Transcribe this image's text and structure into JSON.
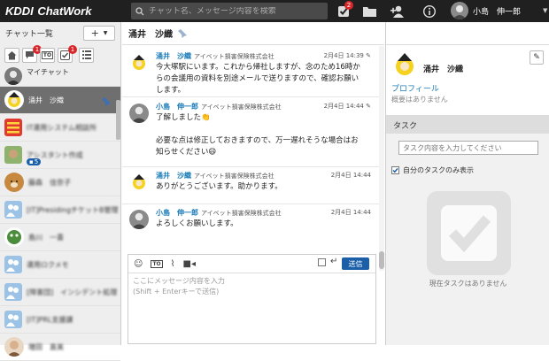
{
  "app": {
    "logo_kddi": "KDDI",
    "logo_chatwork": "ChatWork"
  },
  "topbar": {
    "search_placeholder": "チャット名、メッセージ内容を検索",
    "task_badge": "2",
    "user_name": "小島　伸一郎"
  },
  "left": {
    "header": "チャット一覧",
    "add_label": "+",
    "filter_badges": [
      "1",
      "1"
    ],
    "rooms": [
      {
        "name": "マイチャット",
        "blurred": false
      },
      {
        "name": "涌井　沙織",
        "blurred": false,
        "selected": true
      },
      {
        "name": "IT運用システム相談所",
        "blurred": true
      },
      {
        "name": "アシスタント作成",
        "blurred": true,
        "badge": "5"
      },
      {
        "name": "藤森　佳奈子",
        "blurred": true
      },
      {
        "name": "[IT]PresidingチケットB管理（ステータスなど）",
        "blurred": true
      },
      {
        "name": "島川　一喜",
        "blurred": true
      },
      {
        "name": "運用ロクメモ",
        "blurred": true
      },
      {
        "name": "[障害団]　インシデント処理",
        "blurred": true
      },
      {
        "name": "[IT]PRL支援課",
        "blurred": true
      },
      {
        "name": "増田　直美",
        "blurred": true
      }
    ]
  },
  "chat": {
    "title": "涌井　沙織",
    "messages": [
      {
        "sender": "涌井　沙織",
        "company": "アイベット損害保険株式会社",
        "time": "2月4日 14:39",
        "lines": [
          "今大塚駅にいます。これから帰社しますが、念のため16時か",
          "らの会議用の資料を別途メールで送りますので、確認お願い",
          "します。"
        ]
      },
      {
        "sender": "小島　伸一郎",
        "company": "アイベット損害保険株式会社",
        "time": "2月4日 14:44",
        "lines": [
          "了解しました👏",
          "",
          "必要な点は修正しておきますので、万一遅れそうな場合はお",
          "知らせください😄"
        ]
      },
      {
        "sender": "涌井　沙織",
        "company": "アイベット損害保険株式会社",
        "time": "2月4日 14:44",
        "lines": [
          "ありがとうございます。助かります。"
        ]
      },
      {
        "sender": "小島　伸一郎",
        "company": "アイベット損害保険株式会社",
        "time": "2月4日 14:44",
        "lines": [
          "よろしくお願いします。"
        ]
      }
    ],
    "composer": {
      "placeholder_line1": "ここにメッセージ内容を入力",
      "placeholder_line2": "(Shift + Enterキーで送信)",
      "send_label": "送信",
      "to_label": "TO"
    }
  },
  "right": {
    "profile_name": "涌井　沙織",
    "profile_link": "プロフィール",
    "profile_note": "概要はありません",
    "task_header": "タスク",
    "task_placeholder": "タスク内容を入力してください",
    "my_task_label": "自分のタスクのみ表示",
    "no_task": "現在タスクはありません"
  },
  "colors": {
    "accent": "#1a5fa8",
    "topbar": "#202020",
    "badge": "#d9262b",
    "name_link": "#1a7cb8"
  }
}
